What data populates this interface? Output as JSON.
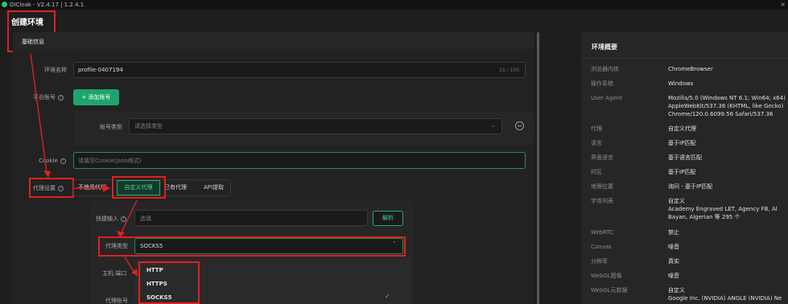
{
  "window": {
    "title": "DICloak - V2.4.17 | 1.2.4.1",
    "close": "×"
  },
  "page": {
    "title": "创建环境"
  },
  "section": {
    "title": "基础信息"
  },
  "form": {
    "env_name_label": "环境名称",
    "env_name_value": "profile-0407194",
    "env_name_counter": "15 / 100",
    "platform_account_label": "平台账号",
    "add_account_label": "+ 添加账号",
    "account_type_label": "账号类型",
    "account_type_placeholder": "请选择类型",
    "cookie_label": "Cookie",
    "cookie_placeholder": "请填写Cookie(Json格式)",
    "proxy_label": "代理设置",
    "proxy_tabs": [
      "不使用代理",
      "自定义代理",
      "已有代理",
      "API提取"
    ],
    "quick_input_label": "快捷输入",
    "quick_input_placeholder": "选填",
    "parse_label": "解析",
    "proxy_type_label": "代理类型",
    "proxy_type_value": "SOCKS5",
    "host_label": "主机:端口",
    "proxy_account_label": "代理账号",
    "proxy_type_options": [
      "HTTP",
      "HTTPS",
      "SOCKS5"
    ],
    "selected_option_check": "✓"
  },
  "overview": {
    "title": "环境概要",
    "rows": [
      {
        "key": "浏览器内核",
        "value": [
          "ChromeBrowser"
        ]
      },
      {
        "key": "操作系统",
        "value": [
          "Windows"
        ]
      },
      {
        "key": "User Agent",
        "value": [
          "Mozilla/5.0 (Windows NT 6.1; Win64; x64)",
          "AppleWebKit/537.36 (KHTML, like Gecko)",
          "Chrome/120.0.6099.56 Safari/537.36"
        ]
      },
      {
        "key": "代理",
        "value": [
          "自定义代理"
        ]
      },
      {
        "key": "语言",
        "value": [
          "基于IP匹配"
        ]
      },
      {
        "key": "界面语言",
        "value": [
          "基于语言匹配"
        ]
      },
      {
        "key": "时区",
        "value": [
          "基于IP匹配"
        ]
      },
      {
        "key": "地理位置",
        "value": [
          "询问 - 基于IP匹配"
        ]
      },
      {
        "key": "字体列表",
        "value": [
          "自定义",
          "Academy Engraved LET, Agency FB, Al",
          "Bayan, Algerian 等 295 个"
        ]
      },
      {
        "key": "WebRTC",
        "value": [
          "禁止"
        ]
      },
      {
        "key": "Canvas",
        "value": [
          "噪音"
        ]
      },
      {
        "key": "分辨率",
        "value": [
          "真实"
        ]
      },
      {
        "key": "WebGL图像",
        "value": [
          "噪音"
        ]
      },
      {
        "key": "WebGL元数据",
        "value": [
          "自定义",
          "Google Inc. (NVIDIA) ANGLE (NVIDIA) Ne"
        ]
      }
    ]
  },
  "colors": {
    "accent": "#1fa36d",
    "annotation": "#e02020",
    "background": "#1e1e1e"
  }
}
